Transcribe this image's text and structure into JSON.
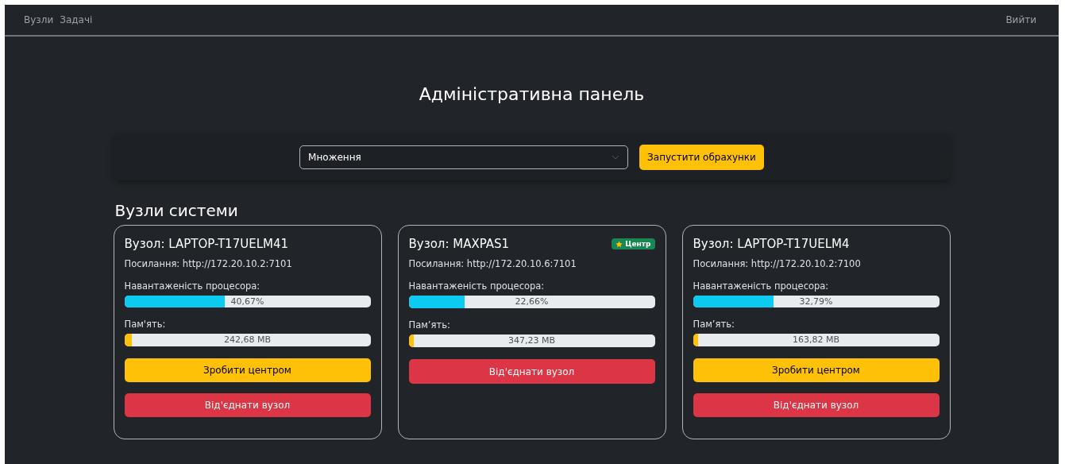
{
  "nav": {
    "links": [
      "Вузли",
      "Задачі"
    ],
    "logout": "Вийти"
  },
  "title": "Адміністративна панель",
  "task_form": {
    "select_value": "Множення",
    "run_button": "Запустити обрахунки"
  },
  "nodes_heading": "Вузли системи",
  "nodes": [
    {
      "name": "Вузол: LAPTOP-T17UELM41",
      "link": "Посилання: http://172.20.10.2:7101",
      "cpu_label": "Навантаженість процесора:",
      "cpu": {
        "level": 0.4067,
        "reading": "40,67%"
      },
      "mem_label": "Пам'ять:",
      "mem": {
        "level": 0.03,
        "reading": "242,68 MB"
      },
      "buttons": [
        {
          "kind": "warning",
          "label": "Зробити центром"
        },
        {
          "kind": "danger",
          "label": "Від'єднати вузол"
        }
      ]
    },
    {
      "name": "Вузол: MAXPAS1",
      "badge": "Центр",
      "link": "Посилання: http://172.20.10.6:7101",
      "cpu_label": "Навантаженість процесора:",
      "cpu": {
        "level": 0.2266,
        "reading": "22,66%"
      },
      "mem_label": "Пам’ять:",
      "mem": {
        "level": 0.02,
        "reading": "347,23 MB"
      },
      "buttons": [
        {
          "kind": "danger",
          "label": "Від'єднати вузол"
        }
      ]
    },
    {
      "name": "Вузол: LAPTOP-T17UELM4",
      "link": "Посилання: http://172.20.10.2:7100",
      "cpu_label": "Навантаженість процесора:",
      "cpu": {
        "level": 0.3279,
        "reading": "32,79%"
      },
      "mem_label": "Пам’ять:",
      "mem": {
        "level": 0.02,
        "reading": "163,82 MB"
      },
      "buttons": [
        {
          "kind": "warning",
          "label": "Зробити центром"
        },
        {
          "kind": "danger",
          "label": "Від'єднати вузол"
        }
      ]
    }
  ]
}
